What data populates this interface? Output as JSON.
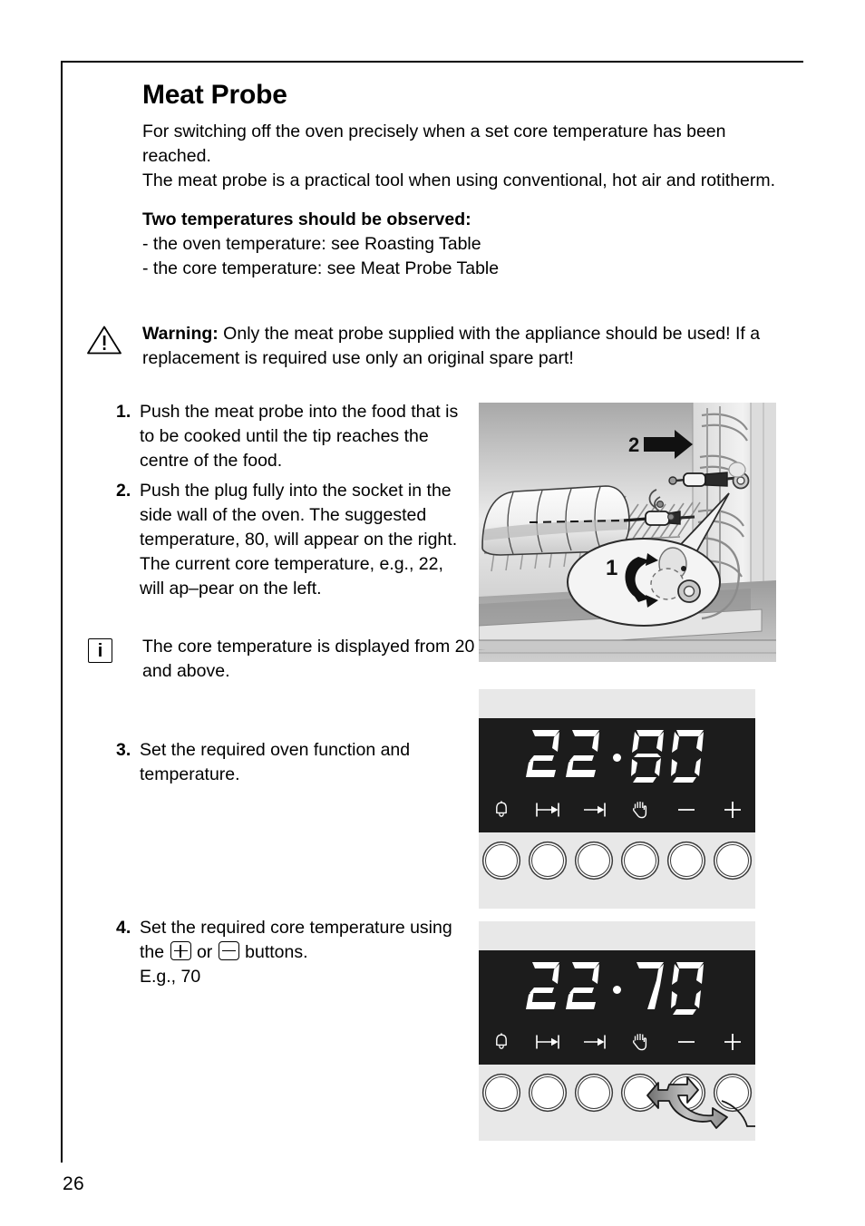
{
  "page": {
    "number": "26"
  },
  "heading": "Meat Probe",
  "intro": {
    "para1": "For switching off the oven precisely when a set core temperature has been reached.",
    "para2": "The meat probe is a practical tool when using conventional, hot air and rotitherm."
  },
  "temperatures": {
    "subhead": "Two temperatures should be observed:",
    "line1": "- the oven temperature: see Roasting Table",
    "line2": "- the core temperature: see Meat Probe Table"
  },
  "warning": {
    "icon": "warning-triangle-icon",
    "label": "Warning:",
    "text": " Only the meat probe supplied with the appliance should be used! If a replacement is required use only an original spare part!"
  },
  "steps": [
    {
      "number": "1.",
      "text": "Push the meat probe into the food that is to be cooked until the tip reaches the centre of the food."
    },
    {
      "number": "2.",
      "text": "Push the plug fully into the socket in the side wall of the oven. The suggested temperature, 80, will appear on the right. The current core temperature, e.g., 22, will ap–pear on the left."
    },
    {
      "number": "3.",
      "text": "Set the required oven function and temperature."
    },
    {
      "number": "4.",
      "text_before": "Set the required core temperature using the ",
      "text_middle": " or ",
      "text_after": " buttons.",
      "example": "E.g., 70",
      "plus_key": "plus-keycap-icon",
      "minus_key": "minus-keycap-icon"
    }
  ],
  "info_note": {
    "icon": "info-i-icon",
    "glyph": "i",
    "text": "The core temperature is displayed from 20 and above."
  },
  "oven_figure": {
    "name": "oven-with-meat-probe-illustration",
    "callout_1": "1",
    "callout_2": "2"
  },
  "panels": [
    {
      "name": "control-panel-step3",
      "display_left": "22",
      "display_right": "80",
      "separator": "·",
      "icons": [
        "bell-icon",
        "cook-duration-icon",
        "end-time-icon",
        "stop-hand-icon",
        "minus-icon",
        "plus-icon"
      ],
      "buttons": [
        "button-bell",
        "button-duration",
        "button-end-time",
        "button-stop",
        "button-minus",
        "button-plus"
      ],
      "has_arrow_annotation": false
    },
    {
      "name": "control-panel-step4",
      "display_left": "22",
      "display_right": "70",
      "separator": "·",
      "icons": [
        "bell-icon",
        "cook-duration-icon",
        "end-time-icon",
        "stop-hand-icon",
        "minus-icon",
        "plus-icon"
      ],
      "buttons": [
        "button-bell",
        "button-duration",
        "button-end-time",
        "button-stop",
        "button-minus",
        "button-plus"
      ],
      "has_arrow_annotation": true,
      "arrow_annotation": "curved-double-arrow-to-plus-minus"
    }
  ],
  "colors": {
    "display_background": "#1c1c1c",
    "panel_background": "#e8e8e8",
    "digit": "#ffffff",
    "text": "#000000"
  }
}
